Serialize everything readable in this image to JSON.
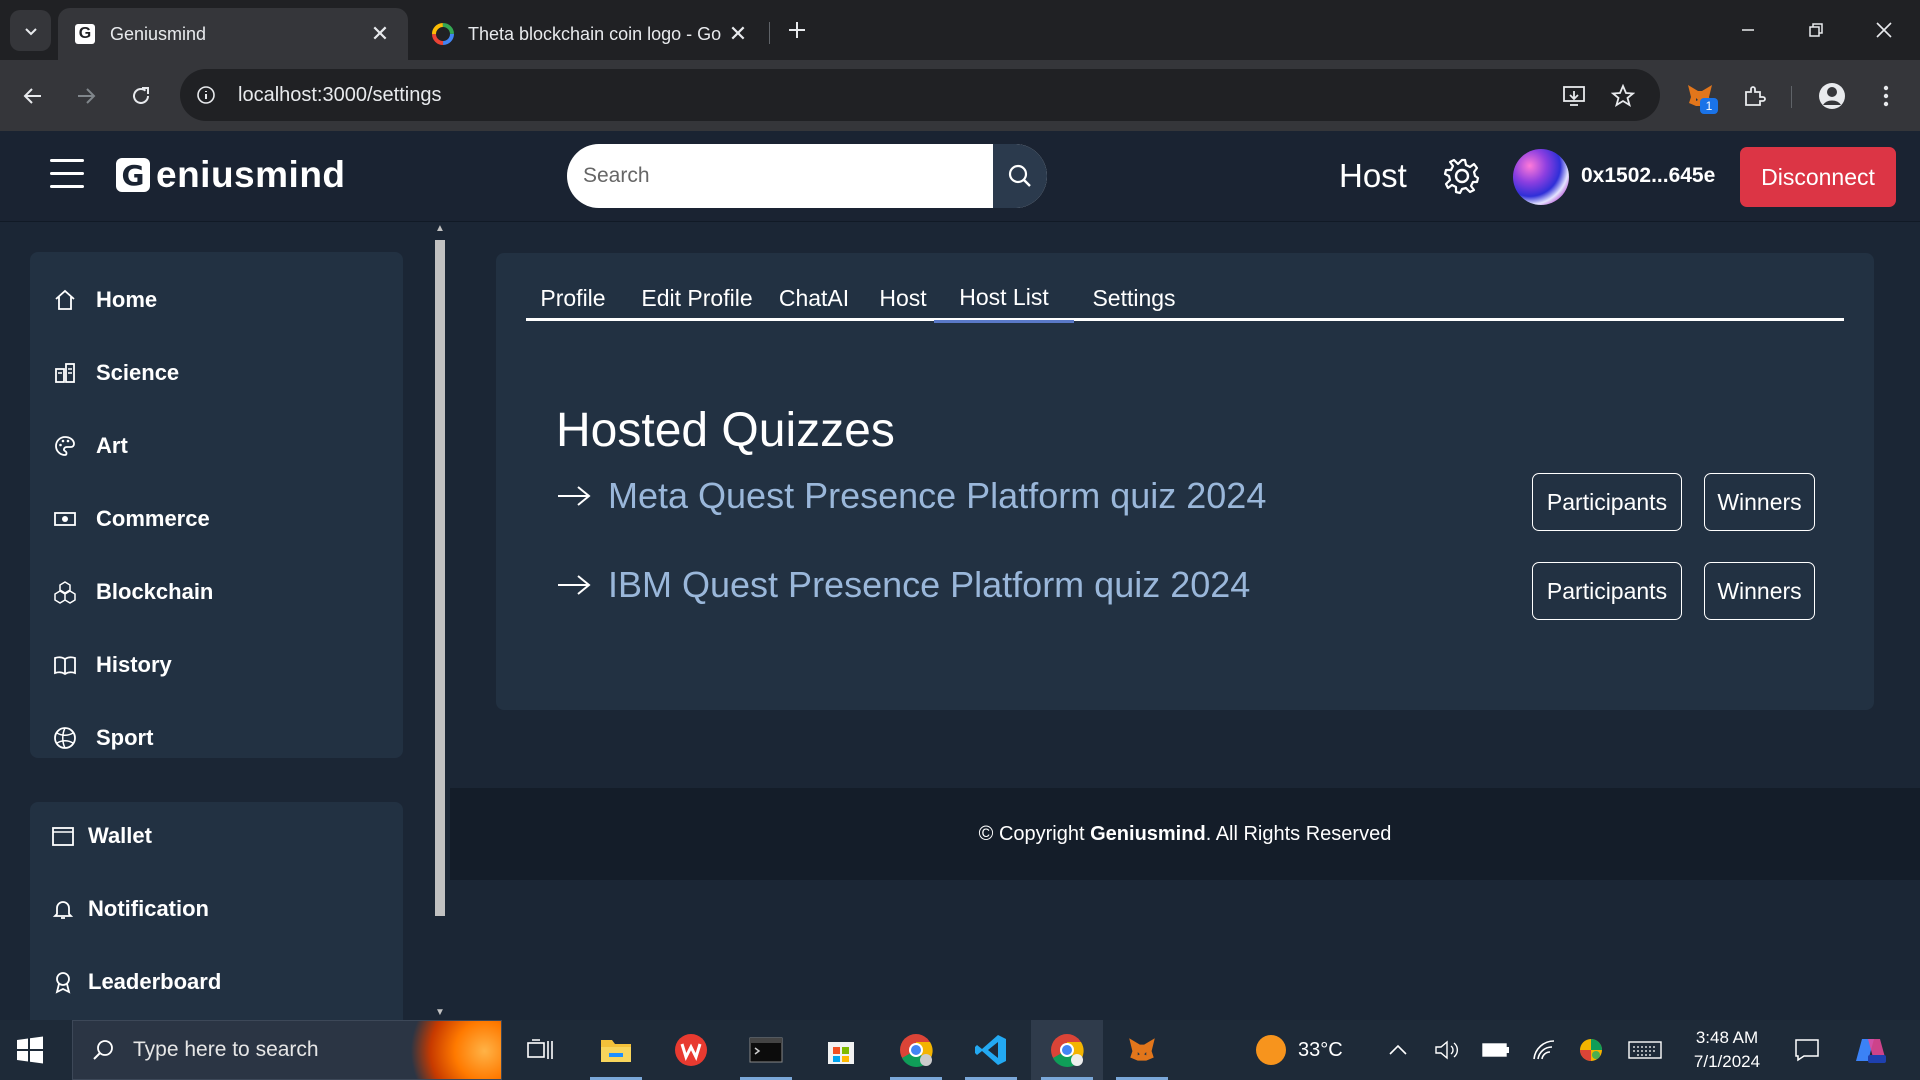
{
  "browser": {
    "tabs": [
      {
        "title": "Geniusmind",
        "active": true
      },
      {
        "title": "Theta blockchain coin logo - Go",
        "active": false
      }
    ],
    "url": "localhost:3000/settings",
    "extension_badge": "1"
  },
  "header": {
    "logo_letter": "G",
    "logo_text": "eniusmind",
    "search_placeholder": "Search",
    "host_link": "Host",
    "wallet_address": "0x1502...645e",
    "disconnect_label": "Disconnect"
  },
  "sidebar": {
    "categories": [
      {
        "label": "Home",
        "icon": "home-icon"
      },
      {
        "label": "Science",
        "icon": "science-icon"
      },
      {
        "label": "Art",
        "icon": "palette-icon"
      },
      {
        "label": "Commerce",
        "icon": "cash-icon"
      },
      {
        "label": "Blockchain",
        "icon": "blockchain-icon"
      },
      {
        "label": "History",
        "icon": "book-icon"
      },
      {
        "label": "Sport",
        "icon": "ball-icon"
      }
    ],
    "account": [
      {
        "label": "Wallet",
        "icon": "wallet-icon"
      },
      {
        "label": "Notification",
        "icon": "bell-icon"
      },
      {
        "label": "Leaderboard",
        "icon": "award-icon"
      }
    ]
  },
  "main": {
    "tabs": [
      {
        "label": "Profile"
      },
      {
        "label": "Edit Profile"
      },
      {
        "label": "ChatAI"
      },
      {
        "label": "Host"
      },
      {
        "label": "Host List",
        "active": true
      },
      {
        "label": "Settings"
      }
    ],
    "section_title": "Hosted Quizzes",
    "quizzes": [
      {
        "name": "Meta Quest Presence Platform quiz 2024",
        "participants_label": "Participants",
        "winners_label": "Winners"
      },
      {
        "name": "IBM Quest Presence Platform quiz 2024",
        "participants_label": "Participants",
        "winners_label": "Winners"
      }
    ]
  },
  "footer": {
    "prefix": "© Copyright ",
    "brand": "Geniusmind",
    "suffix": ". All Rights Reserved"
  },
  "taskbar": {
    "search_placeholder": "Type here to search",
    "weather": "33°C",
    "time": "3:48 AM",
    "date": "7/1/2024"
  },
  "colors": {
    "accent_red": "#dc3545",
    "page_bg": "#1b2635",
    "card_bg": "#223142",
    "quiz_link": "#9ab7da",
    "active_tab_underline": "#5a79c8"
  }
}
